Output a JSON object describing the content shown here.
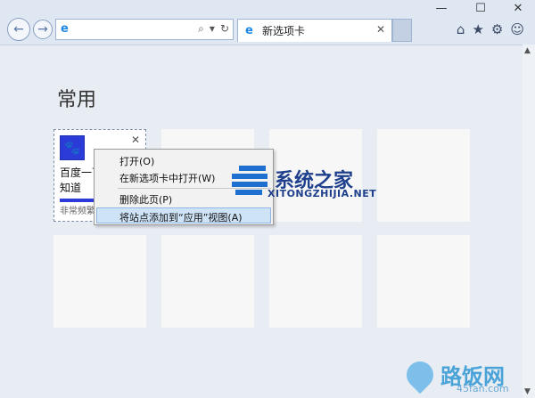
{
  "window": {
    "minimize": "—",
    "maximize": "☐",
    "close": "✕"
  },
  "nav": {
    "back_icon": "←",
    "forward_icon": "→"
  },
  "address": {
    "value": "",
    "search_icon": "⌕",
    "dropdown_icon": "▾",
    "refresh_icon": "↻"
  },
  "tab": {
    "label": "新选项卡",
    "close": "✕"
  },
  "toolbar": {
    "home_icon": "⌂",
    "favorites_icon": "★",
    "settings_icon": "⚙",
    "smiley_icon": "☺"
  },
  "content": {
    "heading": "常用"
  },
  "tile_selected": {
    "title": "百度一下，你就知道",
    "freq": "非常频繁",
    "close": "✕",
    "icon": "🐾"
  },
  "context_menu": {
    "items": [
      "打开(O)",
      "在新选项卡中打开(W)",
      "删除此页(P)",
      "将站点添加到“应用”视图(A)"
    ]
  },
  "watermarks": {
    "site1": "系统之家",
    "site1_url": "XITONGZHIJIA.NET",
    "site2": "路饭网",
    "site2_url": "45fan.com"
  },
  "scrollbar": {
    "up": "▲",
    "down": "▼"
  },
  "colors": {
    "accent": "#2b3bd8",
    "highlight": "#cfe3f7"
  }
}
